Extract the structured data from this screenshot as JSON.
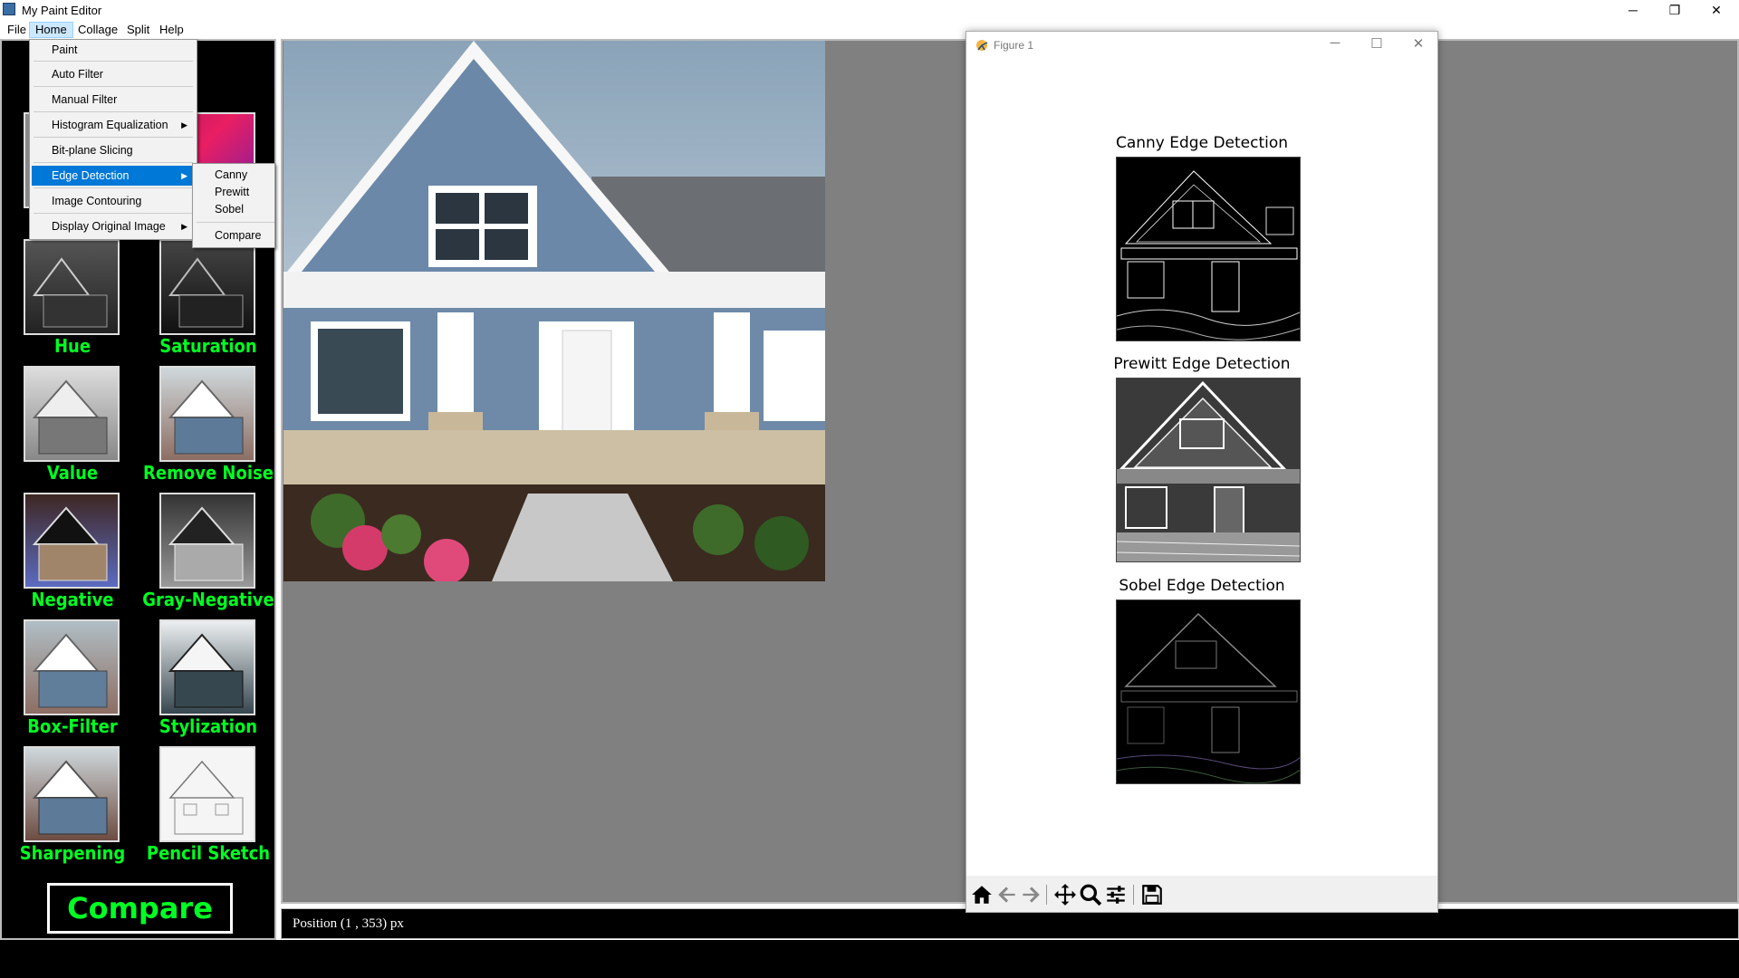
{
  "window": {
    "title": "My Paint Editor",
    "minimize": "─",
    "maximize": "❐",
    "close": "✕"
  },
  "menubar": {
    "items": [
      "File",
      "Home",
      "Collage",
      "Split",
      "Help"
    ],
    "active": "Home"
  },
  "home_menu": {
    "items": [
      {
        "label": "Paint",
        "submenu": false
      },
      {
        "label": "Auto Filter",
        "submenu": false
      },
      {
        "label": "Manual Filter",
        "submenu": false
      },
      {
        "label": "Histogram Equalization",
        "submenu": true
      },
      {
        "label": "Bit-plane Slicing",
        "submenu": false
      },
      {
        "label": "Edge Detection",
        "submenu": true,
        "selected": true
      },
      {
        "label": "Image Contouring",
        "submenu": false
      },
      {
        "label": "Display Original Image",
        "submenu": true
      }
    ]
  },
  "edge_submenu": {
    "items": [
      "Canny",
      "Prewitt",
      "Sobel",
      "Compare"
    ]
  },
  "filters": {
    "hue": "Hue",
    "saturation": "Saturation",
    "value": "Value",
    "remove_noise": "Remove Noise",
    "negative": "Negative",
    "gray_negative": "Gray-Negative",
    "box_filter": "Box-Filter",
    "stylization": "Stylization",
    "sharpening": "Sharpening",
    "pencil_sketch": "Pencil Sketch"
  },
  "compare_button": "Compare",
  "status": {
    "position": "Position (1 , 353) px"
  },
  "figure": {
    "title": "Figure 1",
    "plots": [
      "Canny Edge Detection",
      "Prewitt Edge Detection",
      "Sobel Edge Detection"
    ],
    "toolbar_icons": [
      "home-icon",
      "back-icon",
      "forward-icon",
      "pan-icon",
      "zoom-icon",
      "configure-icon",
      "save-icon"
    ],
    "minimize": "─",
    "maximize": "☐",
    "close": "✕"
  },
  "colors": {
    "accent_green": "#00ff22",
    "menu_select": "#0078d7",
    "canvas_gray": "#808080"
  }
}
